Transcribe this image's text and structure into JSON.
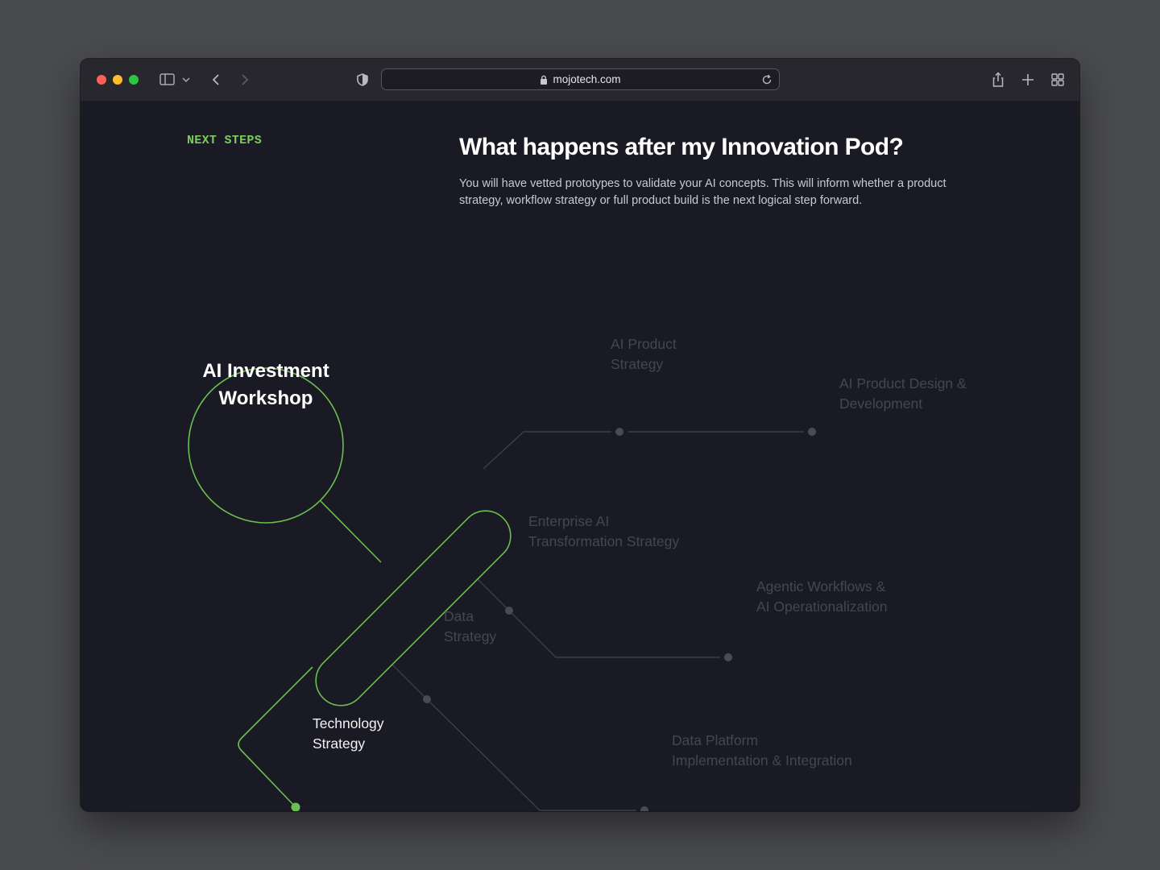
{
  "browser": {
    "url": "mojotech.com"
  },
  "page": {
    "eyebrow": "NEXT STEPS",
    "headline": "What happens after my Innovation Pod?",
    "subtext": "You will have vetted prototypes to validate your AI concepts. This will inform whether a product strategy, workflow strategy or full product build is the next logical step forward."
  },
  "diagram": {
    "center": "AI Investment\nWorkshop",
    "nodes": [
      {
        "label": "AI Product\nStrategy",
        "active": false
      },
      {
        "label": "AI Product Design &\nDevelopment",
        "active": false
      },
      {
        "label": "Enterprise AI\nTransformation Strategy",
        "active": false
      },
      {
        "label": "Agentic Workflows &\nAI Operationalization",
        "active": false
      },
      {
        "label": "Data\nStrategy",
        "active": false
      },
      {
        "label": "Data Platform\nImplementation & Integration",
        "active": false
      },
      {
        "label": "Technology\nStrategy",
        "active": true
      }
    ],
    "colors": {
      "accent": "#6bbf4e",
      "line": "#3c3c46",
      "dot": "#4a4a56",
      "inactive_text": "#464651",
      "active_text": "#f2f2f4"
    }
  }
}
